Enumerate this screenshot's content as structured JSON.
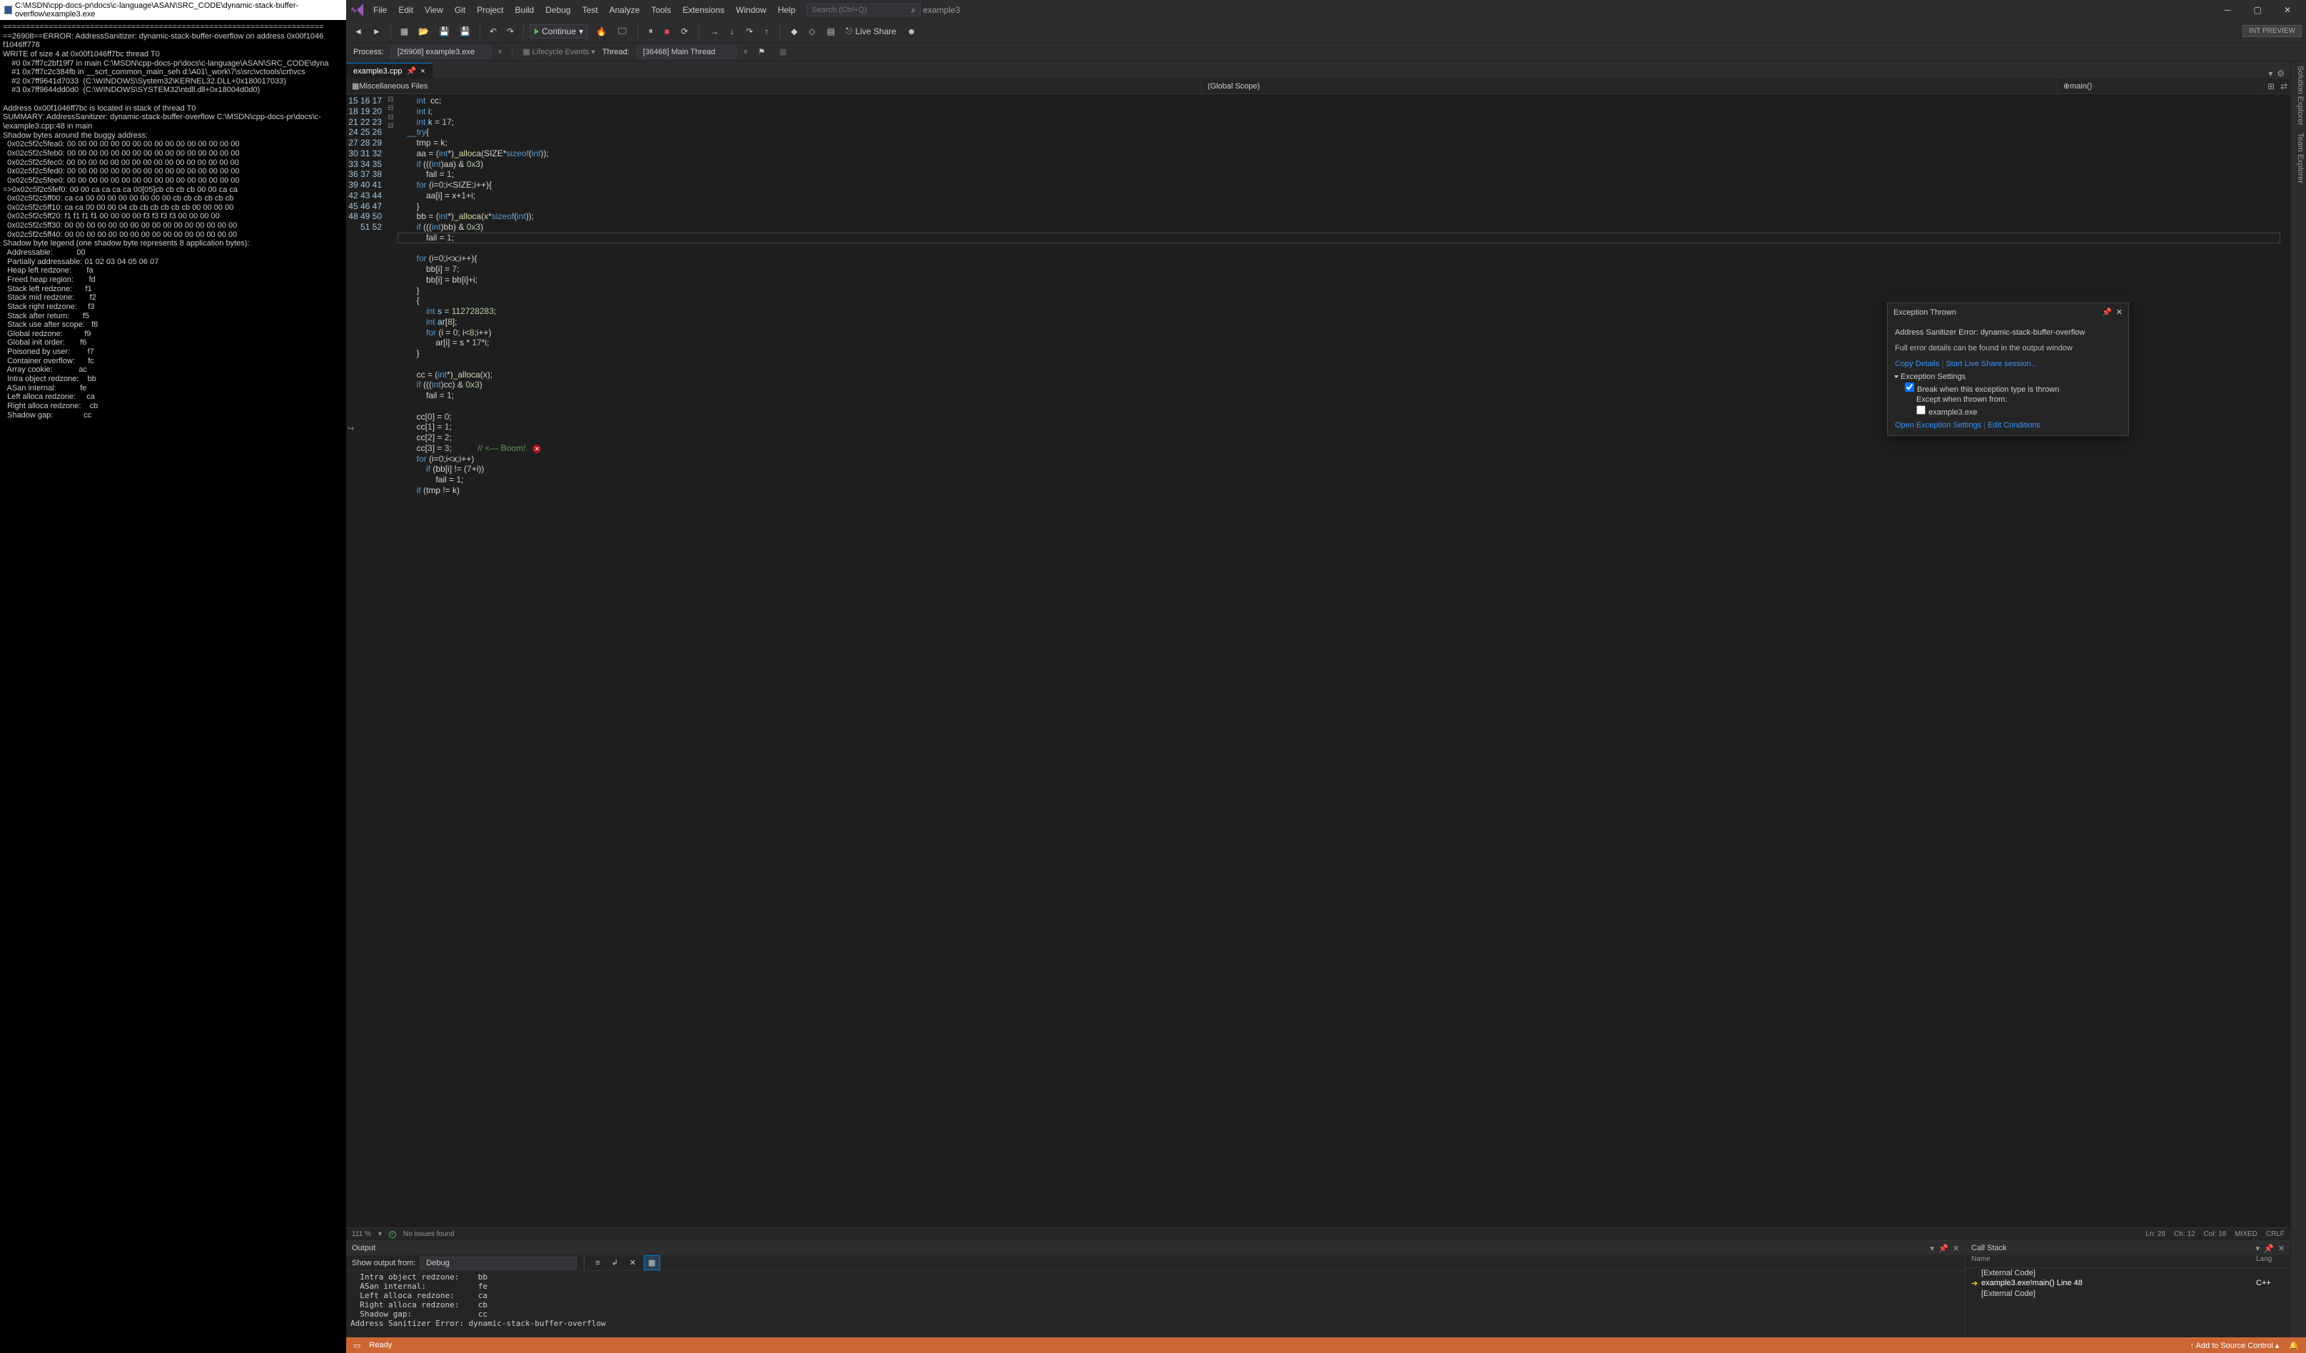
{
  "console": {
    "title": "C:\\MSDN\\cpp-docs-pr\\docs\\c-language\\ASAN\\SRC_CODE\\dynamic-stack-buffer-overflow\\example3.exe",
    "lines": [
      "======================================================================",
      "==26908==ERROR: AddressSanitizer: dynamic-stack-buffer-overflow on address 0x00f1046",
      "f1046ff778",
      "WRITE of size 4 at 0x00f1046ff7bc thread T0",
      "    #0 0x7ff7c2bf19f7 in main C:\\MSDN\\cpp-docs-pr\\docs\\c-language\\ASAN\\SRC_CODE\\dyna",
      "    #1 0x7ff7c2c384fb in __scrt_common_main_seh d:\\A01\\_work\\7\\s\\src\\vctools\\crt\\vcs",
      "    #2 0x7ff9641d7033  (C:\\WINDOWS\\System32\\KERNEL32.DLL+0x180017033)",
      "    #3 0x7ff9644dd0d0  (C:\\WINDOWS\\SYSTEM32\\ntdll.dll+0x18004d0d0)",
      "",
      "Address 0x00f1046ff7bc is located in stack of thread T0",
      "SUMMARY: AddressSanitizer: dynamic-stack-buffer-overflow C:\\MSDN\\cpp-docs-pr\\docs\\c-",
      "\\example3.cpp:48 in main",
      "Shadow bytes around the buggy address:",
      "  0x02c5f2c5fea0: 00 00 00 00 00 00 00 00 00 00 00 00 00 00 00 00",
      "  0x02c5f2c5feb0: 00 00 00 00 00 00 00 00 00 00 00 00 00 00 00 00",
      "  0x02c5f2c5fec0: 00 00 00 00 00 00 00 00 00 00 00 00 00 00 00 00",
      "  0x02c5f2c5fed0: 00 00 00 00 00 00 00 00 00 00 00 00 00 00 00 00",
      "  0x02c5f2c5fee0: 00 00 00 00 00 00 00 00 00 00 00 00 00 00 00 00",
      "=>0x02c5f2c5fef0: 00 00 ca ca ca ca 00[05]cb cb cb cb 00 00 ca ca",
      "  0x02c5f2c5ff00: ca ca 00 00 00 00 00 00 00 00 cb cb cb cb cb cb",
      "  0x02c5f2c5ff10: ca ca 00 00 00 04 cb cb cb cb cb cb 00 00 00 00",
      "  0x02c5f2c5ff20: f1 f1 f1 f1 00 00 00 00 f3 f3 f3 f3 00 00 00 00",
      "  0x02c5f2c5ff30: 00 00 00 00 00 00 00 00 00 00 00 00 00 00 00 00",
      "  0x02c5f2c5ff40: 00 00 00 00 00 00 00 00 00 00 00 00 00 00 00 00",
      "Shadow byte legend (one shadow byte represents 8 application bytes):",
      "  Addressable:           00",
      "  Partially addressable: 01 02 03 04 05 06 07",
      "  Heap left redzone:       fa",
      "  Freed heap region:       fd",
      "  Stack left redzone:      f1",
      "  Stack mid redzone:       f2",
      "  Stack right redzone:     f3",
      "  Stack after return:      f5",
      "  Stack use after scope:   f8",
      "  Global redzone:          f9",
      "  Global init order:       f6",
      "  Poisoned by user:        f7",
      "  Container overflow:      fc",
      "  Array cookie:            ac",
      "  Intra object redzone:    bb",
      "  ASan internal:           fe",
      "  Left alloca redzone:     ca",
      "  Right alloca redzone:    cb",
      "  Shadow gap:              cc"
    ]
  },
  "menu": [
    "File",
    "Edit",
    "View",
    "Git",
    "Project",
    "Build",
    "Debug",
    "Test",
    "Analyze",
    "Tools",
    "Extensions",
    "Window",
    "Help"
  ],
  "search_placeholder": "Search (Ctrl+Q)",
  "window_title": "example3",
  "toolbar": {
    "continue": "Continue",
    "int_preview": "INT PREVIEW",
    "live_share": "Live Share"
  },
  "process_bar": {
    "process_label": "Process:",
    "process_value": "[26908] example3.exe",
    "lifecycle": "Lifecycle Events",
    "thread_label": "Thread:",
    "thread_value": "[36468] Main Thread"
  },
  "tab": {
    "name": "example3.cpp",
    "close": "×"
  },
  "nav": {
    "left": "Miscellaneous Files",
    "mid": "(Global Scope)",
    "right": "main()"
  },
  "code_lines": [
    {
      "n": 16,
      "html": "        <span class='kw'>int</span> <span class='id'>i</span>;"
    },
    {
      "n": 17,
      "html": "        <span class='kw'>int</span> <span class='id'>k</span> = <span class='num'>17</span>;"
    },
    {
      "n": 18,
      "html": "    <span class='kw'>__try</span>{"
    },
    {
      "n": 19,
      "html": "        tmp = k;"
    },
    {
      "n": 20,
      "html": "        aa = (<span class='kw'>int</span>*)<span class='fn'>_alloca</span>(SIZE*<span class='kw'>sizeof</span>(<span class='kw'>int</span>));"
    },
    {
      "n": 21,
      "html": "        <span class='kw'>if</span> (((<span class='kw'>int</span>)aa) &amp; <span class='num'>0x3</span>)"
    },
    {
      "n": 22,
      "html": "            fail = <span class='num'>1</span>;"
    },
    {
      "n": 23,
      "html": "        <span class='kw'>for</span> (i=<span class='num'>0</span>;i&lt;SIZE;i++){"
    },
    {
      "n": 24,
      "html": "            aa[i] = x+<span class='num'>1</span>+i;"
    },
    {
      "n": 25,
      "html": "        }"
    },
    {
      "n": 26,
      "html": "        bb = (<span class='kw'>int</span>*)<span class='fn'>_alloca</span>(x*<span class='kw'>sizeof</span>(<span class='kw'>int</span>));"
    },
    {
      "n": 27,
      "html": "        <span class='kw'>if</span> (((<span class='kw'>int</span>)bb) &amp; <span class='num'>0x3</span>)"
    },
    {
      "n": 28,
      "html": "            fail = <span class='num'>1</span>;"
    },
    {
      "n": 29,
      "html": ""
    },
    {
      "n": 30,
      "html": "        <span class='kw'>for</span> (i=<span class='num'>0</span>;i&lt;x;i++){"
    },
    {
      "n": 31,
      "html": "            bb[i] = <span class='num'>7</span>;"
    },
    {
      "n": 32,
      "html": "            bb[i] = bb[i]+i;"
    },
    {
      "n": 33,
      "html": "        }"
    },
    {
      "n": 34,
      "html": "        {"
    },
    {
      "n": 35,
      "html": "            <span class='kw'>int</span> <span class='id'>s</span> = <span class='num'>112728283</span>;"
    },
    {
      "n": 36,
      "html": "            <span class='kw'>int</span> <span class='id'>ar</span>[<span class='num'>8</span>];"
    },
    {
      "n": 37,
      "html": "            <span class='kw'>for</span> (i = <span class='num'>0</span>; i&lt;<span class='num'>8</span>;i++)"
    },
    {
      "n": 38,
      "html": "                ar[i] = s * <span class='num'>17</span>*i;"
    },
    {
      "n": 39,
      "html": "        }"
    },
    {
      "n": 40,
      "html": ""
    },
    {
      "n": 41,
      "html": "        cc = (<span class='kw'>int</span>*)<span class='fn'>_alloca</span>(x);"
    },
    {
      "n": 42,
      "html": "        <span class='kw'>if</span> (((<span class='kw'>int</span>)cc) &amp; <span class='num'>0x3</span>)"
    },
    {
      "n": 43,
      "html": "            fail = <span class='num'>1</span>;"
    },
    {
      "n": 44,
      "html": ""
    },
    {
      "n": 45,
      "html": "        cc[<span class='num'>0</span>] = <span class='num'>0</span>;"
    },
    {
      "n": 46,
      "html": "        cc[<span class='num'>1</span>] = <span class='num'>1</span>;"
    },
    {
      "n": 47,
      "html": "        cc[<span class='num'>2</span>] = <span class='num'>2</span>;"
    },
    {
      "n": 48,
      "html": "        cc[<span class='num'>3</span>] = <span class='num'>3</span>;           <span class='cm'>// &lt;--- Boom!</span><span class='err-dot'>✕</span>"
    },
    {
      "n": 49,
      "html": "        <span class='kw'>for</span> (i=<span class='num'>0</span>;i&lt;x;i++)"
    },
    {
      "n": 50,
      "html": "            <span class='kw'>if</span> (bb[i] != (<span class='num'>7</span>+i))"
    },
    {
      "n": 51,
      "html": "                fail = <span class='num'>1</span>;"
    },
    {
      "n": 52,
      "html": "        <span class='kw'>if</span> (tmp != k)"
    }
  ],
  "exception": {
    "title": "Exception Thrown",
    "msg": "Address Sanitizer Error: dynamic-stack-buffer-overflow",
    "details": "Full error details can be found in the output window",
    "copy": "Copy Details",
    "share": "Start Live Share session...",
    "settings_head": "Exception Settings",
    "break": "Break when this exception type is thrown",
    "except": "Except when thrown from:",
    "except_item": "example3.exe",
    "open": "Open Exception Settings",
    "edit": "Edit Conditions"
  },
  "editor_status": {
    "zoom": "111 %",
    "issues": "No issues found",
    "ln": "Ln: 28",
    "ch": "Ch: 12",
    "col": "Col: 18",
    "mode": "MIXED",
    "eol": "CRLF"
  },
  "output": {
    "title": "Output",
    "show_from": "Show output from:",
    "source": "Debug",
    "lines": [
      "  Intra object redzone:    bb",
      "  ASan internal:           fe",
      "  Left alloca redzone:     ca",
      "  Right alloca redzone:    cb",
      "  Shadow gap:              cc",
      "Address Sanitizer Error: dynamic-stack-buffer-overflow"
    ]
  },
  "callstack": {
    "title": "Call Stack",
    "col_name": "Name",
    "col_lang": "Lang",
    "rows": [
      {
        "name": "[External Code]",
        "lang": "",
        "arrow": false
      },
      {
        "name": "example3.exe!main() Line 48",
        "lang": "C++",
        "arrow": true
      },
      {
        "name": "[External Code]",
        "lang": "",
        "arrow": false
      }
    ]
  },
  "statusbar": {
    "ready": "Ready",
    "add_source": "Add to Source Control"
  },
  "sidebars": [
    "Solution Explorer",
    "Team Explorer"
  ]
}
